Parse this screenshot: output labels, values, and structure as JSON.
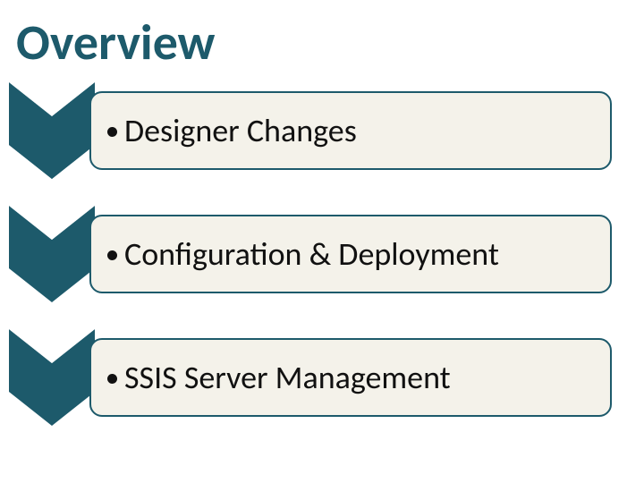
{
  "title": "Overview",
  "items": [
    {
      "label": "Designer Changes"
    },
    {
      "label": "Configuration & Deployment"
    },
    {
      "label": "SSIS Server Management"
    }
  ],
  "colors": {
    "accent": "#1d5a6b",
    "box_bg": "#f4f2ea",
    "text": "#111111"
  }
}
